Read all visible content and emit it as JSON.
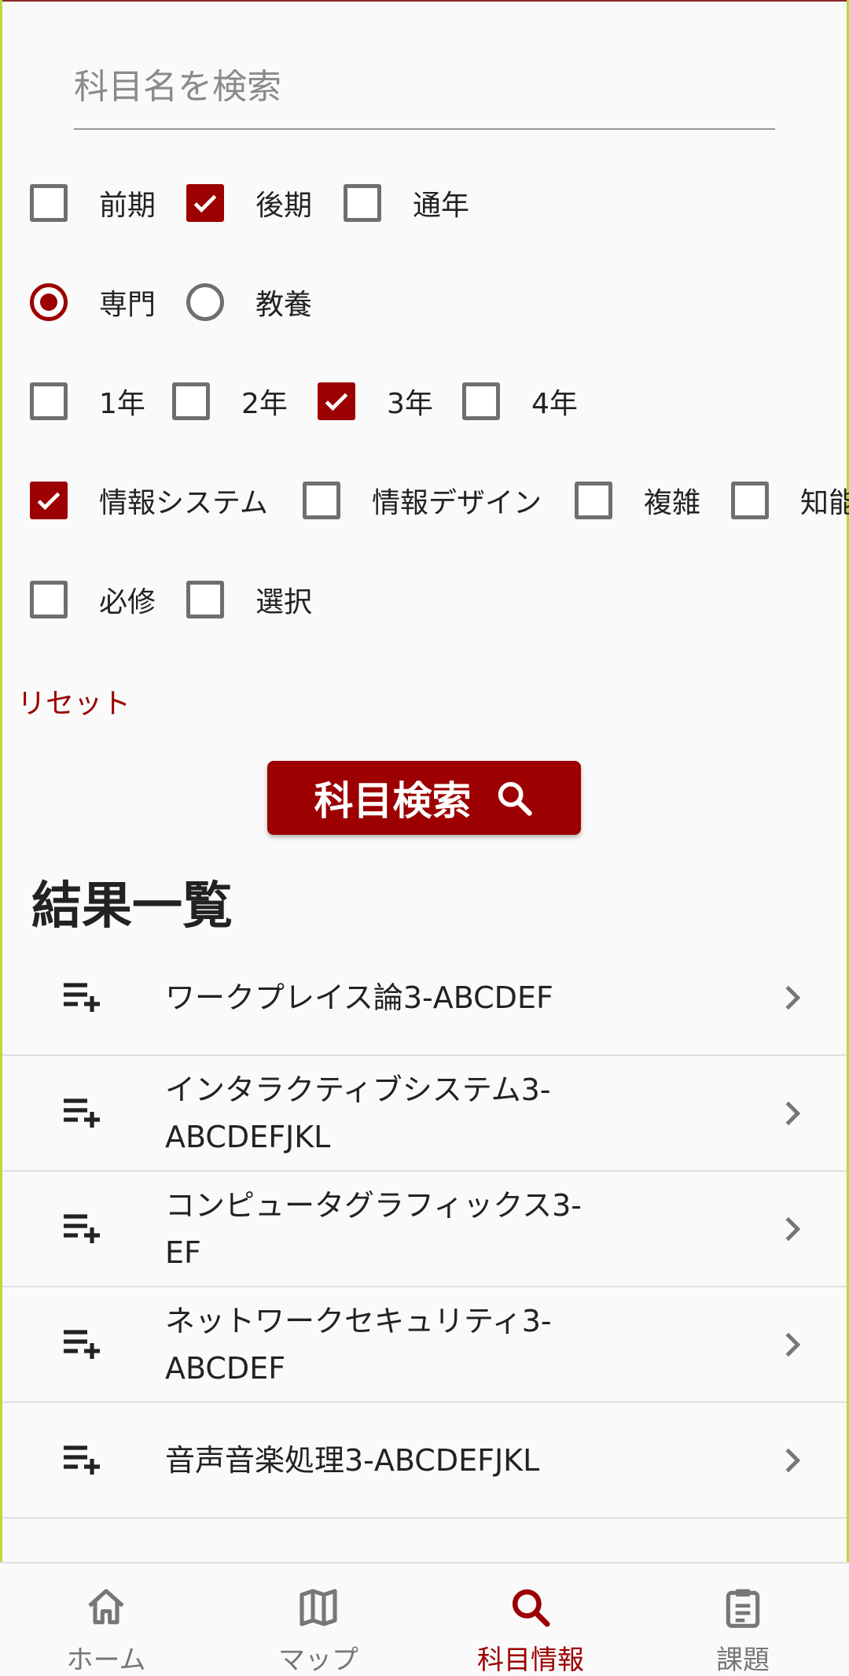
{
  "search": {
    "placeholder": "科目名を検索",
    "value": ""
  },
  "filters": {
    "semester": [
      {
        "label": "前期",
        "checked": false
      },
      {
        "label": "後期",
        "checked": true
      },
      {
        "label": "通年",
        "checked": false
      }
    ],
    "category": [
      {
        "label": "専門",
        "selected": true
      },
      {
        "label": "教養",
        "selected": false
      }
    ],
    "grade": [
      {
        "label": "1年",
        "checked": false
      },
      {
        "label": "2年",
        "checked": false
      },
      {
        "label": "3年",
        "checked": true
      },
      {
        "label": "4年",
        "checked": false
      }
    ],
    "course": [
      {
        "label": "情報システム",
        "checked": true
      },
      {
        "label": "情報デザイン",
        "checked": false
      },
      {
        "label": "複雑",
        "checked": false
      },
      {
        "label": "知能",
        "checked": false
      }
    ],
    "requirement": [
      {
        "label": "必修",
        "checked": false
      },
      {
        "label": "選択",
        "checked": false
      }
    ]
  },
  "reset_label": "リセット",
  "search_button_label": "科目検索",
  "results_title": "結果一覧",
  "results": [
    {
      "title": "ワークプレイス論3-ABCDEF"
    },
    {
      "title": "インタラクティブシステム3-ABCDEFJKL"
    },
    {
      "title": "コンピュータグラフィックス3-EF"
    },
    {
      "title": "ネットワークセキュリティ3-ABCDEF"
    },
    {
      "title": "音声音楽処理3-ABCDEFJKL"
    }
  ],
  "nav": [
    {
      "label": "ホーム",
      "icon": "home-icon",
      "active": false
    },
    {
      "label": "マップ",
      "icon": "map-icon",
      "active": false
    },
    {
      "label": "科目情報",
      "icon": "search-icon",
      "active": true
    },
    {
      "label": "課題",
      "icon": "clipboard-icon",
      "active": false
    }
  ],
  "colors": {
    "accent": "#9c0000",
    "inactive": "#6f6f6f"
  }
}
